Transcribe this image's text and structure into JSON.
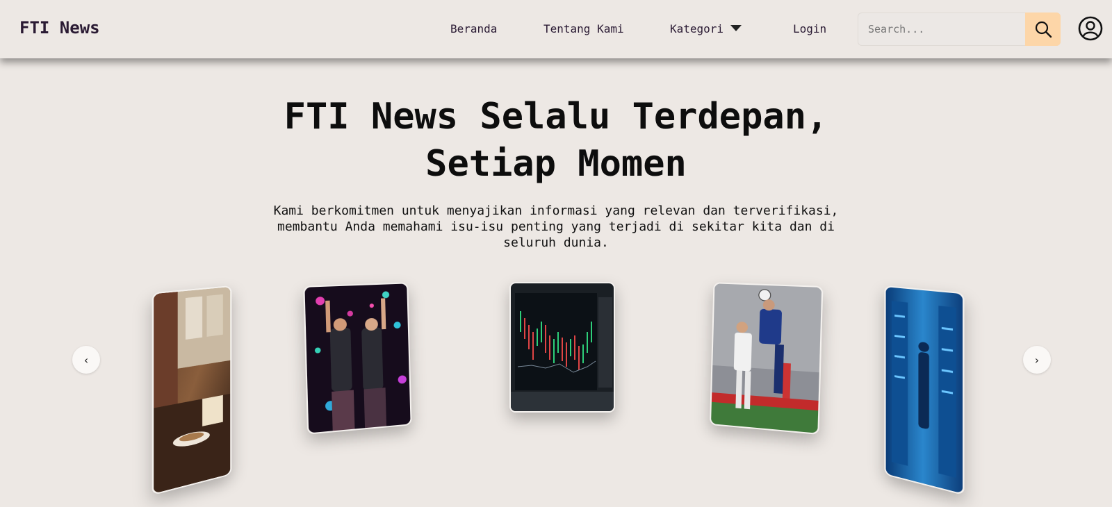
{
  "header": {
    "brand": "FTI News",
    "nav": {
      "home": "Beranda",
      "about": "Tentang Kami",
      "category": "Kategori",
      "login": "Login"
    },
    "search": {
      "placeholder": "Search..."
    },
    "accent_color": "#fdd6a8"
  },
  "hero": {
    "title_line1": "FTI News Selalu Terdepan,",
    "title_line2": "Setiap Momen",
    "subtitle_line1": "Kami berkomitmen untuk menyajikan informasi yang relevan dan terverifikasi,",
    "subtitle_line2": "membantu Anda memahami isu-isu penting yang terjadi di sekitar kita dan di",
    "subtitle_line3": "seluruh dunia."
  },
  "carousel": {
    "prev_label": "‹",
    "next_label": "›",
    "cards": [
      {
        "subject": "coffee-cup-by-window"
      },
      {
        "subject": "band-on-concert-stage"
      },
      {
        "subject": "stock-chart-on-monitor"
      },
      {
        "subject": "football-header-match"
      },
      {
        "subject": "server-room-corridor"
      }
    ]
  },
  "icons": {
    "search": "search-icon",
    "profile": "user-circle-icon",
    "dropdown": "caret-down-icon"
  }
}
